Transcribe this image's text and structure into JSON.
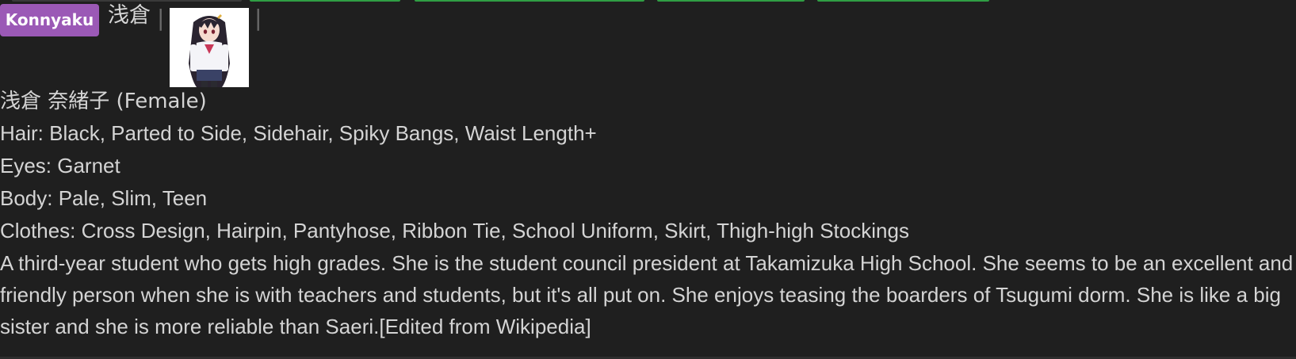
{
  "colors": {
    "tab_accent": "#2f9e44",
    "badge_background": "#9b59b6",
    "page_background": "#1f1f1f",
    "text": "#d4d4d4"
  },
  "header": {
    "tag_label": "Konnyaku",
    "name_short": "浅倉",
    "separator": "|"
  },
  "character": {
    "full_name": "浅倉 奈緒子 (Female)",
    "portrait_icon": "character-portrait-icon",
    "traits": [
      {
        "label": "Hair: ",
        "value": "Black, Parted to Side, Sidehair, Spiky Bangs, Waist Length+"
      },
      {
        "label": "Eyes: ",
        "value": "Garnet"
      },
      {
        "label": "Body: ",
        "value": "Pale, Slim, Teen"
      },
      {
        "label": "Clothes: ",
        "value": "Cross Design, Hairpin, Pantyhose, Ribbon Tie, School Uniform, Skirt, Thigh-high Stockings"
      }
    ],
    "description": "A third-year student who gets high grades. She is the student council president at Takamizuka High School. She seems to be an excellent and friendly person when she is with teachers and students, but it's all put on. She enjoys teasing the boarders of Tsugumi dorm. She is like a big sister and she is more reliable than Saeri.[Edited from Wikipedia]"
  }
}
